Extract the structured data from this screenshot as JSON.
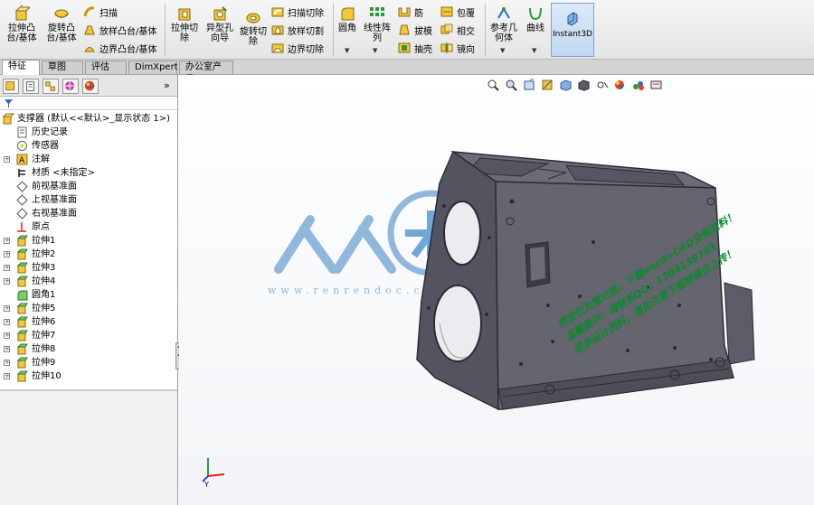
{
  "ribbon": {
    "extrude_boss": "拉伸凸\n台/基体",
    "revolve_boss": "旋转凸\n台/基体",
    "sweep": "扫描",
    "loft_boss": "放样凸台/基体",
    "boundary_boss": "边界凸台/基体",
    "extrude_cut": "拉伸切\n除",
    "hole_wizard": "异型孔\n向导",
    "revolve_cut": "旋转切\n除",
    "swept_cut": "扫描切除",
    "lofted_cut": "放样切割",
    "boundary_cut": "边界切除",
    "fillet": "圆角",
    "linear_pattern": "线性阵\n列",
    "rib": "筋",
    "draft": "拔模",
    "shell": "抽壳",
    "wrap": "包覆",
    "intersect": "相交",
    "mirror": "镜向",
    "ref_geometry": "参考几\n何体",
    "curves": "曲线",
    "instant3d": "Instant3D"
  },
  "tabs": [
    "特征",
    "草图",
    "评估",
    "DimXpert",
    "办公室产品"
  ],
  "tree": {
    "root": "支撑器  (默认<<默认>_显示状态 1>)",
    "items": [
      {
        "label": "历史记录",
        "exp": false
      },
      {
        "label": "传感器",
        "exp": false
      },
      {
        "label": "注解",
        "exp": true
      },
      {
        "label": "材质 <未指定>",
        "exp": false
      },
      {
        "label": "前视基准面",
        "exp": false
      },
      {
        "label": "上视基准面",
        "exp": false
      },
      {
        "label": "右视基准面",
        "exp": false
      },
      {
        "label": "原点",
        "exp": false
      },
      {
        "label": "拉伸1",
        "exp": true
      },
      {
        "label": "拉伸2",
        "exp": true
      },
      {
        "label": "拉伸3",
        "exp": true
      },
      {
        "label": "拉伸4",
        "exp": true
      },
      {
        "label": "圆角1",
        "exp": false
      },
      {
        "label": "拉伸5",
        "exp": true
      },
      {
        "label": "拉伸6",
        "exp": true
      },
      {
        "label": "拉伸7",
        "exp": true
      },
      {
        "label": "拉伸8",
        "exp": true
      },
      {
        "label": "拉伸9",
        "exp": true
      },
      {
        "label": "拉伸10",
        "exp": true
      }
    ]
  },
  "watermark": {
    "logo_text": "人人文库",
    "url": "www.renrendoc.com",
    "notice_lines": [
      "预览仅为第分面，下载word+CAD全套资料！",
      "温馨提示：请联系QQ：1304139763",
      "很多设计资料，请先注意下载前请点上传！"
    ]
  },
  "triad": {
    "y_label": "Y"
  },
  "colors": {
    "model_body": "#5c5d68",
    "model_edge": "#2b2c33",
    "ribbon_bg": "#eeeeee",
    "accent": "#7da2ce",
    "watermark_green": "#0b8a2c",
    "watermark_blue": "#8fb8dc"
  }
}
